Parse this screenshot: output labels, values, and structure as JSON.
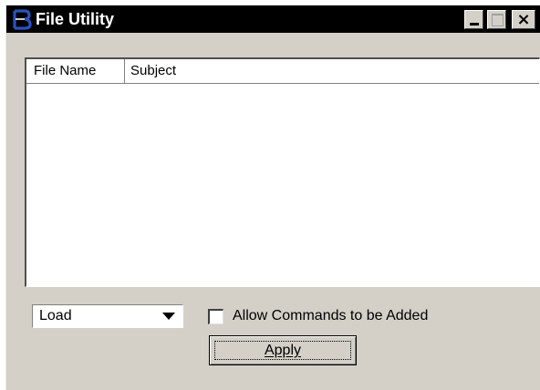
{
  "window": {
    "title": "File Utility",
    "icon": "bentley-b-icon",
    "controls": {
      "minimize": "minimize-icon",
      "maximize": "maximize-icon",
      "close": "close-icon",
      "close_glyph": "×"
    }
  },
  "list": {
    "columns": [
      "File Name",
      "Subject"
    ],
    "rows": []
  },
  "mode_select": {
    "value": "Load",
    "icon": "dropdown-arrow-icon"
  },
  "allow_commands": {
    "label": "Allow Commands to be Added",
    "checked": false
  },
  "apply_button": {
    "label": "Apply"
  },
  "colors": {
    "titlebar": "#000000",
    "dialog": "#d4d0c8",
    "icon_blue": "#2a52be"
  }
}
